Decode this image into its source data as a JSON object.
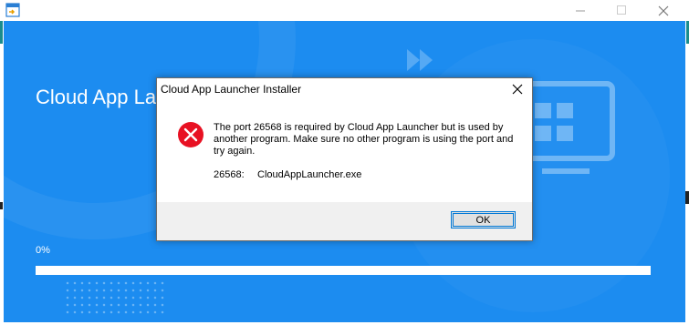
{
  "window": {
    "icon": "installer-app-icon",
    "controls": {
      "minimize": "minimize-icon",
      "maximize": "maximize-icon",
      "close": "close-icon"
    }
  },
  "installer": {
    "title": "Cloud App La",
    "progress_label": "0%",
    "progress_value": 0,
    "accent_color": "#1c8cf0"
  },
  "dialog": {
    "title": "Cloud App Launcher Installer",
    "icon": "error-icon",
    "message": "The port 26568 is required by Cloud App Launcher but is used by another program. Make sure no other program is using the port and try again.",
    "detail_port": "26568:",
    "detail_process": "CloudAppLauncher.exe",
    "ok_label": "OK",
    "error_color": "#e81123"
  }
}
